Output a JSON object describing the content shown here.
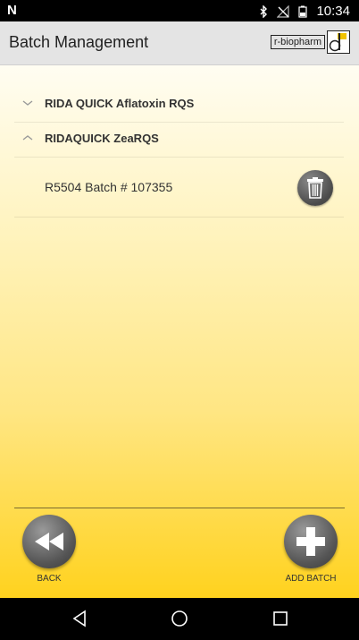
{
  "status": {
    "carrier_icon": "N",
    "time": "10:34",
    "icons": [
      "bluetooth-icon",
      "no-signal-icon",
      "battery-icon"
    ]
  },
  "appbar": {
    "title": "Batch Management",
    "logo_text": "r-biopharm"
  },
  "groups": [
    {
      "title": "RIDA QUICK Aflatoxin RQS",
      "expanded": false
    },
    {
      "title": "RIDAQUICK ZeaRQS",
      "expanded": true,
      "batches": [
        {
          "label": "R5504 Batch # 107355"
        }
      ]
    }
  ],
  "footer": {
    "back_label": "BACK",
    "add_label": "ADD BATCH"
  },
  "colors": {
    "gradient_top": "#fffdf2",
    "gradient_bottom": "#ffd21e",
    "button_gray": "#555555"
  }
}
